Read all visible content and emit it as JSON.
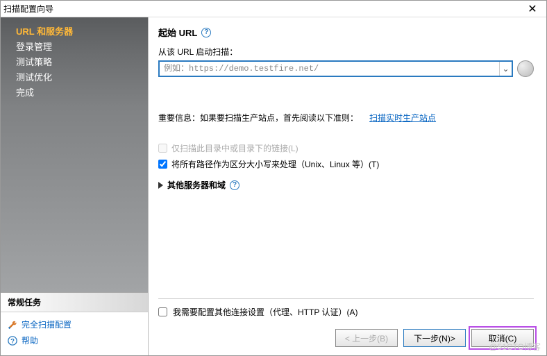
{
  "window": {
    "title": "扫描配置向导"
  },
  "sidebar": {
    "items": [
      {
        "label": "URL 和服务器"
      },
      {
        "label": "登录管理"
      },
      {
        "label": "测试策略"
      },
      {
        "label": "测试优化"
      },
      {
        "label": "完成"
      }
    ]
  },
  "tasks": {
    "header": "常规任务",
    "items": [
      {
        "label": "完全扫描配置"
      },
      {
        "label": "帮助"
      }
    ]
  },
  "main": {
    "section_title": "起始 URL",
    "label_start_from": "从该 URL 启动扫描：",
    "url_placeholder": "例如：https://demo.testfire.net/",
    "url_value": "",
    "info_prefix": "重要信息：如果要扫描生产站点，首先阅读以下准则：",
    "info_link": "扫描实时生产站点",
    "checkbox_only_under": "仅扫描此目录中或目录下的链接(L)",
    "checkbox_case_sensitive": "将所有路径作为区分大小写来处理（Unix、Linux 等）(T)",
    "expand_other": "其他服务器和域",
    "checkbox_connection": "我需要配置其他连接设置（代理、HTTP 认证）(A)"
  },
  "footer": {
    "back": "< 上一步(B)",
    "next": "下一步(N)>",
    "cancel": "取消(C)"
  },
  "watermark": "@51CTO博客"
}
